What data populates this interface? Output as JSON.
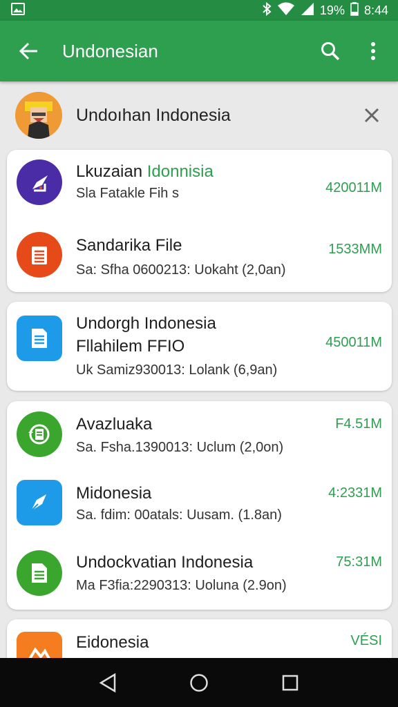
{
  "status_bar": {
    "battery_percent": "19%",
    "time": "8:44",
    "icons": [
      "image-icon",
      "bluetooth-icon",
      "wifi-icon",
      "signal-icon",
      "battery-icon"
    ]
  },
  "app_bar": {
    "title": "Undonesian",
    "icons": [
      "back-arrow-icon",
      "search-icon",
      "more-vert-icon"
    ],
    "color": "#2e9e4f"
  },
  "header": {
    "title": "Undoıhan Indonesia"
  },
  "cards": [
    {
      "items": [
        {
          "name_prefix": "Lkuzaian ",
          "name_highlight": "Idonnisia",
          "sub": "Sla Fatakle Fih s",
          "size": "420011M",
          "icon": "brush-palette-icon",
          "color": "#4a2da6"
        },
        {
          "name": "Sandarika File",
          "sub": "Sa: Sfha 0600213: Uokaht (2,0an)",
          "size": "1533MM",
          "icon": "document-list-icon",
          "color": "#e64a19"
        }
      ]
    },
    {
      "items": [
        {
          "name": "Undorgh Indonesia",
          "name2": "Fllahilem FFIO",
          "sub": "Uk Samiz930013: Lolank (6,9an)",
          "size": "450011M",
          "icon": "file-text-icon",
          "color": "#1e9be8"
        }
      ]
    },
    {
      "items": [
        {
          "name": "Avazluaka",
          "sub": "Sa. Fsha.1390013: Uclum (2,0on)",
          "size": "F4.51M",
          "icon": "sync-document-icon",
          "color": "#3aa62e"
        },
        {
          "name": "Midonesia",
          "sub": "Sa. fdim: 00atals: Uusam. (1.8an)",
          "size": "4:2331M",
          "icon": "pen-nib-icon",
          "color": "#1e9be8"
        },
        {
          "name": "Undockvatian Indonesia",
          "sub": "Ma F3fia:2290313: Uoluna (2.9on)",
          "size": "75:31M",
          "icon": "document-icon",
          "color": "#3aa62e"
        }
      ]
    },
    {
      "items": [
        {
          "name": "Eidonesia",
          "size": "VÉSI",
          "icon": "mountain-icon",
          "color": "#f57c1f"
        }
      ]
    }
  ],
  "nav_bar": {
    "icons": [
      "back-triangle-icon",
      "home-circle-icon",
      "recents-square-icon"
    ]
  }
}
